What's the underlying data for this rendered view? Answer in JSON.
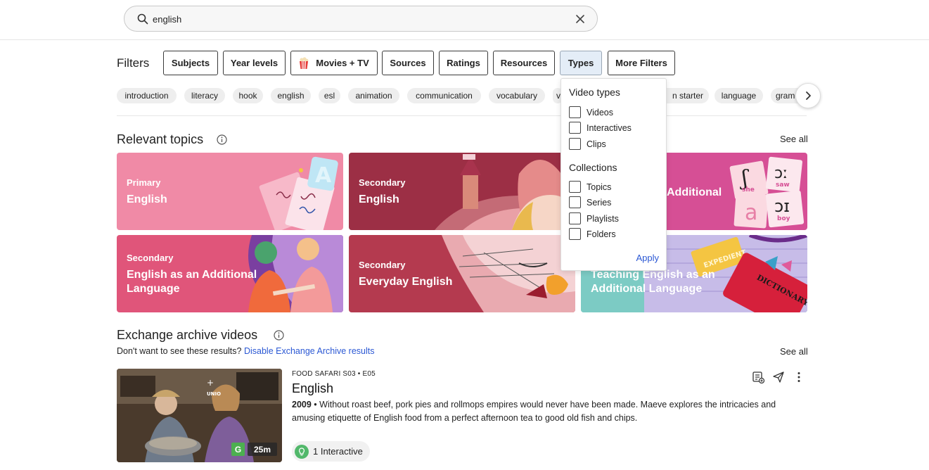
{
  "search": {
    "value": "english",
    "placeholder": ""
  },
  "filters": {
    "label": "Filters",
    "buttons": [
      "Subjects",
      "Year levels",
      "Movies + TV",
      "Sources",
      "Ratings",
      "Resources",
      "Types",
      "More Filters"
    ],
    "active": "Types"
  },
  "tags": [
    "introduction",
    "literacy",
    "hook",
    "english",
    "esl",
    "animation",
    "communication",
    "vocabulary",
    "v",
    "n starter",
    "language",
    "gram"
  ],
  "types_dropdown": {
    "video_types_heading": "Video types",
    "video_types": [
      "Videos",
      "Interactives",
      "Clips"
    ],
    "collections_heading": "Collections",
    "collections": [
      "Topics",
      "Series",
      "Playlists",
      "Folders"
    ],
    "apply_label": "Apply"
  },
  "relevant_topics": {
    "title": "Relevant topics",
    "see_all": "See all",
    "cards": [
      {
        "kicker": "Primary",
        "name": "English"
      },
      {
        "kicker": "Secondary",
        "name": "English"
      },
      {
        "kicker": "",
        "name": "Additional"
      },
      {
        "kicker": "Secondary",
        "name": "English as an Additional Language"
      },
      {
        "kicker": "Secondary",
        "name": "Everyday English"
      },
      {
        "kicker": "",
        "name": "Teaching English as an Additional Language"
      }
    ],
    "card_art_text": {
      "expedient": "EXPEDIENT",
      "dictionary": "DICTIONARY",
      "she": "she",
      "saw": "saw",
      "boy": "boy"
    }
  },
  "exchange": {
    "title": "Exchange archive videos",
    "see_all": "See all",
    "note_text": "Don't want to see these results?",
    "note_link": "Disable Exchange Archive results",
    "video": {
      "meta": "FOOD SAFARI S03 • E05",
      "title": "English",
      "year": "2009",
      "bullet": "•",
      "description": "Without roast beef, pork pies and rollmops empires would never have been made. Maeve explores the intricacies and amusing etiquette of English food from a perfect afternoon tea to good old fish and chips.",
      "rating": "G",
      "duration": "25m",
      "interactives": "1 Interactive"
    }
  },
  "colors": {
    "link": "#2b58d4",
    "card1": "#f08aa6",
    "card2": "#9c2f45",
    "card3": "#d64f95",
    "card4": "#e0557a",
    "card5": "#b43a4f",
    "card6": "#6ec7bf"
  }
}
